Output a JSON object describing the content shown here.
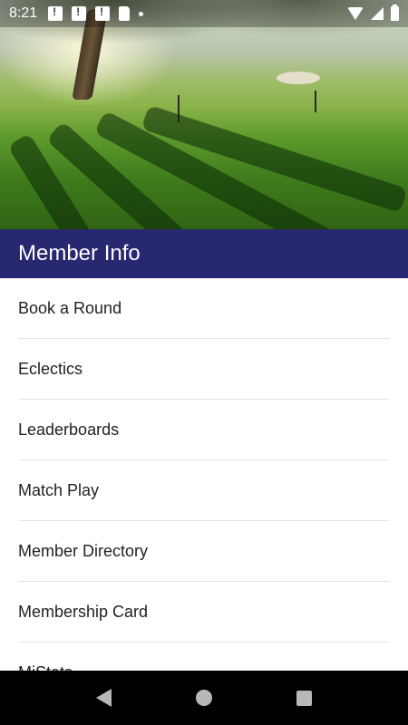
{
  "status_bar": {
    "time": "8:21",
    "left_icons": [
      "notification-icon",
      "notification-icon",
      "notification-icon",
      "sd-card-icon",
      "dot-icon"
    ],
    "right_icons": [
      "wifi-icon",
      "signal-icon",
      "battery-icon"
    ]
  },
  "hero": {
    "description_icon": "golf-course-image"
  },
  "header": {
    "title": "Member Info",
    "background_color": "#27286f"
  },
  "menu": {
    "items": [
      {
        "label": "Book a Round"
      },
      {
        "label": "Eclectics"
      },
      {
        "label": "Leaderboards"
      },
      {
        "label": "Match Play"
      },
      {
        "label": "Member Directory"
      },
      {
        "label": "Membership Card"
      },
      {
        "label": "MiStats"
      }
    ]
  },
  "nav_bar": {
    "buttons": [
      "back-icon",
      "home-icon",
      "recents-icon"
    ]
  }
}
